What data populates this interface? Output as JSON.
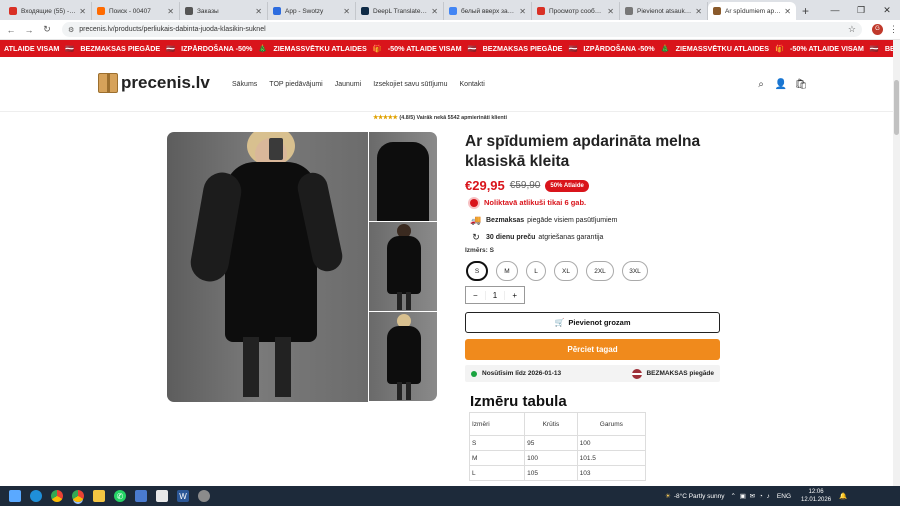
{
  "browser": {
    "tabs": [
      {
        "title": "Входящие (55) - olga",
        "color": "#d93025",
        "active": false
      },
      {
        "title": "Поиск - 00407",
        "color": "#ff6a00",
        "active": false
      },
      {
        "title": "Заказы",
        "color": "#555555",
        "active": false
      },
      {
        "title": "App - Swotzy",
        "color": "#2d6cdf",
        "active": false
      },
      {
        "title": "DeepL Translate – Си",
        "color": "#0f2b46",
        "active": false
      },
      {
        "title": "белый вверх защит",
        "color": "#4285f4",
        "active": false
      },
      {
        "title": "Просмотр сообщен",
        "color": "#d93025",
        "active": false
      },
      {
        "title": "Pievienot atsauksm",
        "color": "#777777",
        "active": false
      },
      {
        "title": "Ar spīdumiem apdar",
        "color": "#8a5a2b",
        "active": true
      }
    ],
    "url": "precenis.lv/products/perliukais-dabinta-juoda-klasikin-suknel",
    "profile_initial": "G"
  },
  "marquee": {
    "items": [
      "ATLAIDE VISAM",
      "🇱🇻",
      "BEZMAKSAS PIEGĀDE",
      "🇱🇻",
      "IZPĀRDOŠANA -50%",
      "🎄",
      "ZIEMASSVĒTKU ATLAIDES",
      "🎁",
      "-50% ATLAIDE VISAM",
      "🇱🇻",
      "BEZMAKSAS PIEGĀDE",
      "🇱🇻",
      "IZPĀRDOŠANA -50%",
      "🎄",
      "ZIEMASSVĒTKU ATLAIDES",
      "🎁",
      "-50% ATLAIDE VISAM",
      "🇱🇻",
      "BEZMAKSAS PIEGĀDE",
      "🇱🇻",
      "IZ"
    ]
  },
  "store": {
    "logo_text": "precenis.lv",
    "menu": [
      "Sākums",
      "TOP piedāvājumi",
      "Jaunumi",
      "Izsekojiet savu sūtījumu",
      "Kontakti"
    ]
  },
  "rating": {
    "stars": "★★★★★",
    "text": "(4.8/5) Vairāk nekā 5542 apmierināti klienti"
  },
  "product": {
    "title": "Ar spīdumiem apdarināta melna klasiskā kleita",
    "price": "€29,95",
    "old_price": "€59,90",
    "discount_badge": "50% Atlaide",
    "stock_text": "Noliktavā atlikuši tikai 6 gab.",
    "features": [
      {
        "bold": "Bezmaksas",
        "text": "piegāde visiem pasūtījumiem",
        "icon": "🚚"
      },
      {
        "bold": "30 dienu preču",
        "text": "atgriešanas garantija",
        "icon": "↻"
      }
    ],
    "size_label": "Izmērs: S",
    "sizes": [
      "S",
      "M",
      "L",
      "XL",
      "2XL",
      "3XL"
    ],
    "selected_size": "S",
    "quantity": "1",
    "add_to_cart": "Pievienot grozam",
    "buy_now": "Pērciet tagad",
    "shipping_date": "Nosūtīsim līdz 2026-01-13",
    "shipping_badge": "BEZMAKSAS piegāde"
  },
  "size_table": {
    "title": "Izmēru tabula",
    "headers": [
      "Izmēri",
      "Krūtis",
      "Garums"
    ],
    "rows": [
      [
        "S",
        "95",
        "100"
      ],
      [
        "M",
        "100",
        "101.5"
      ],
      [
        "L",
        "105",
        "103"
      ]
    ]
  },
  "taskbar": {
    "weather": "-8°C  Partly sunny",
    "lang": "ENG",
    "time": "12:06",
    "date": "12.01.2026"
  }
}
